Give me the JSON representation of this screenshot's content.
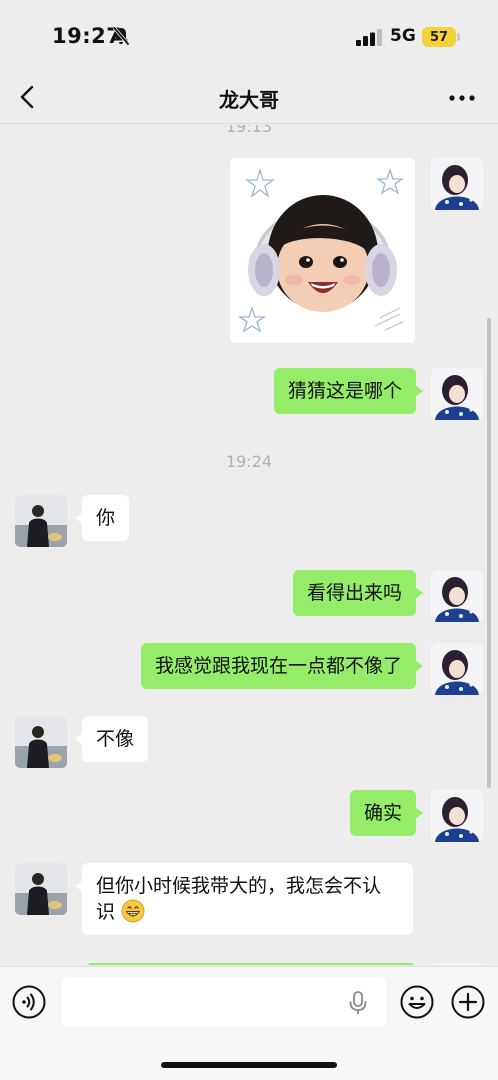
{
  "status_bar": {
    "time": "19:27",
    "network": "5G",
    "battery": "57"
  },
  "nav": {
    "title": "龙大哥"
  },
  "chat": {
    "timestamps": [
      "19:13",
      "19:24"
    ],
    "messages": [
      {
        "sender": "me",
        "type": "sticker"
      },
      {
        "sender": "me",
        "text": "猜猜这是哪个"
      },
      {
        "sender": "other",
        "text": "你"
      },
      {
        "sender": "me",
        "text": "看得出来吗"
      },
      {
        "sender": "me",
        "text": "我感觉跟我现在一点都不像了"
      },
      {
        "sender": "other",
        "text": "不像"
      },
      {
        "sender": "me",
        "text": "确实"
      },
      {
        "sender": "other",
        "text": "但你小时候我带大的，我怎会不认识"
      }
    ]
  },
  "input": {
    "value": "",
    "placeholder": ""
  },
  "icons": {
    "back": "chevron-left-icon",
    "more": "more-dots-icon",
    "voice": "voice-icon",
    "mic": "mic-icon",
    "emoji": "emoji-icon",
    "add": "plus-circle-icon"
  },
  "colors": {
    "my_bubble": "#95ec69",
    "their_bubble": "#ffffff",
    "background": "#ededed",
    "battery": "#f6d23a"
  }
}
